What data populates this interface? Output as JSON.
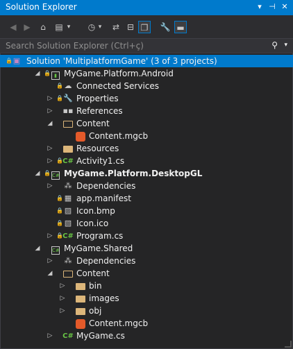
{
  "window": {
    "title": "Solution Explorer"
  },
  "search": {
    "placeholder": "Search Solution Explorer (Ctrl+ç)"
  },
  "tree": [
    {
      "label": "Solution 'MultiplatformGame' (3 of 3 projects)",
      "icon": "solution-icon",
      "expand": "",
      "level": 0,
      "selected": true
    },
    {
      "label": "MyGame.Platform.Android",
      "icon": "project-icon",
      "expand": "open",
      "level": 1
    },
    {
      "label": "Connected Services",
      "icon": "cloud-icon",
      "expand": "",
      "level": 2
    },
    {
      "label": "Properties",
      "icon": "wrench-icon",
      "expand": "closed",
      "level": 2
    },
    {
      "label": "References",
      "icon": "references-icon",
      "expand": "closed",
      "level": 2
    },
    {
      "label": "Content",
      "icon": "folder-open-icon",
      "expand": "open",
      "level": 2
    },
    {
      "label": "Content.mgcb",
      "icon": "monogame-icon",
      "expand": "",
      "level": 3
    },
    {
      "label": "Resources",
      "icon": "folder-icon",
      "expand": "closed",
      "level": 2
    },
    {
      "label": "Activity1.cs",
      "icon": "csharp-icon",
      "expand": "closed",
      "level": 2
    },
    {
      "label": "MyGame.Platform.DesktopGL",
      "icon": "csproj-icon",
      "expand": "open",
      "level": 1,
      "bold": true
    },
    {
      "label": "Dependencies",
      "icon": "dependencies-icon",
      "expand": "closed",
      "level": 2
    },
    {
      "label": "app.manifest",
      "icon": "manifest-icon",
      "expand": "",
      "level": 2
    },
    {
      "label": "Icon.bmp",
      "icon": "image-icon",
      "expand": "",
      "level": 2
    },
    {
      "label": "Icon.ico",
      "icon": "ico-icon",
      "expand": "",
      "level": 2
    },
    {
      "label": "Program.cs",
      "icon": "csharp-icon",
      "expand": "closed",
      "level": 2
    },
    {
      "label": "MyGame.Shared",
      "icon": "shared-project-icon",
      "expand": "open",
      "level": 1
    },
    {
      "label": "Dependencies",
      "icon": "dependencies-icon",
      "expand": "closed",
      "level": 2
    },
    {
      "label": "Content",
      "icon": "folder-open-icon",
      "expand": "open",
      "level": 2
    },
    {
      "label": "bin",
      "icon": "folder-icon",
      "expand": "closed",
      "level": 3
    },
    {
      "label": "images",
      "icon": "folder-icon",
      "expand": "closed",
      "level": 3
    },
    {
      "label": "obj",
      "icon": "folder-icon",
      "expand": "closed",
      "level": 3
    },
    {
      "label": "Content.mgcb",
      "icon": "monogame-icon",
      "expand": "",
      "level": 3
    },
    {
      "label": "MyGame.cs",
      "icon": "csharp-icon",
      "expand": "closed",
      "level": 2
    }
  ],
  "colors": {
    "accent": "#007acc",
    "background": "#252526",
    "folder": "#dcb67a",
    "csharp": "#68c445",
    "monogame": "#e45a2a"
  }
}
